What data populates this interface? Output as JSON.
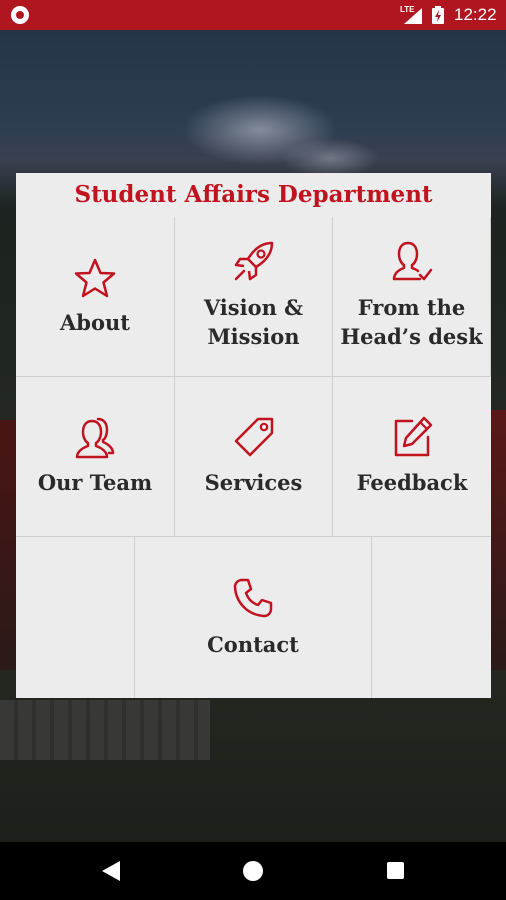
{
  "status_bar": {
    "network_label": "LTE",
    "time": "12:22",
    "icons": [
      "notification-icon",
      "signal-icon",
      "battery-icon"
    ]
  },
  "card": {
    "title": "Student Affairs Department",
    "tiles": [
      {
        "label_line1": "About",
        "label_line2": "",
        "icon": "star-icon"
      },
      {
        "label_line1": "Vision &",
        "label_line2": "Mission",
        "icon": "rocket-icon"
      },
      {
        "label_line1": "From the",
        "label_line2": "Head’s desk",
        "icon": "user-check-icon"
      },
      {
        "label_line1": "Our Team",
        "label_line2": "",
        "icon": "users-icon"
      },
      {
        "label_line1": "Services",
        "label_line2": "",
        "icon": "tag-icon"
      },
      {
        "label_line1": "Feedback",
        "label_line2": "",
        "icon": "edit-icon"
      },
      {
        "label_line1": "Contact",
        "label_line2": "",
        "icon": "phone-icon"
      }
    ]
  },
  "colors": {
    "status_bar": "#b0161f",
    "accent": "#c1121f",
    "tile_background": "#ececec",
    "tile_text": "#2a2a2a"
  },
  "nav_bar": {
    "buttons": [
      "back-icon",
      "home-icon",
      "recents-icon"
    ]
  }
}
